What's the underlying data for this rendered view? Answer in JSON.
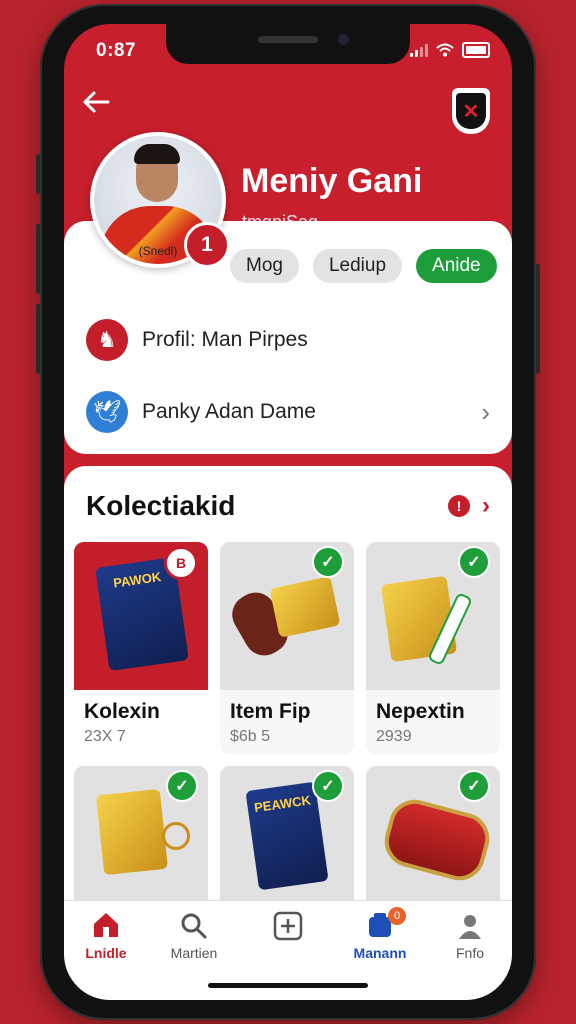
{
  "status": {
    "time": "0:87"
  },
  "profile": {
    "name": "Meniy Gani",
    "handle": "tmgpiSag",
    "avatar_tag": "(Snedl)",
    "notif_count": "1",
    "chips": [
      "Mog",
      "Lediup",
      "Anide"
    ]
  },
  "menu": [
    {
      "label": "Profil: Man Pirpes",
      "icon": "horse-icon"
    },
    {
      "label": "Panky Adan Dame",
      "icon": "bird-icon"
    }
  ],
  "collection": {
    "title": "Kolectiakid",
    "badge_label": "B",
    "tiles_row1": [
      {
        "title": "Kolexin",
        "price": "23X 7",
        "pack_text": "PAWOK"
      },
      {
        "title": "Item Fip",
        "price": "$6b 5"
      },
      {
        "title": "Nepextin",
        "price": "2939"
      }
    ],
    "tiles_row2_packs": [
      "PEAWCK"
    ]
  },
  "bottom_nav": [
    {
      "label": "Lnidle",
      "icon": "home-icon",
      "active": true
    },
    {
      "label": "Martien",
      "icon": "search-icon"
    },
    {
      "label": "",
      "icon": "add-icon"
    },
    {
      "label": "Manann",
      "icon": "cards-icon",
      "badge": "0"
    },
    {
      "label": "Fnfo",
      "icon": "profile-icon"
    }
  ],
  "colors": {
    "brand_red": "#c41e2b",
    "success_green": "#1e9e3a",
    "primary_blue": "#1e4fb8"
  }
}
